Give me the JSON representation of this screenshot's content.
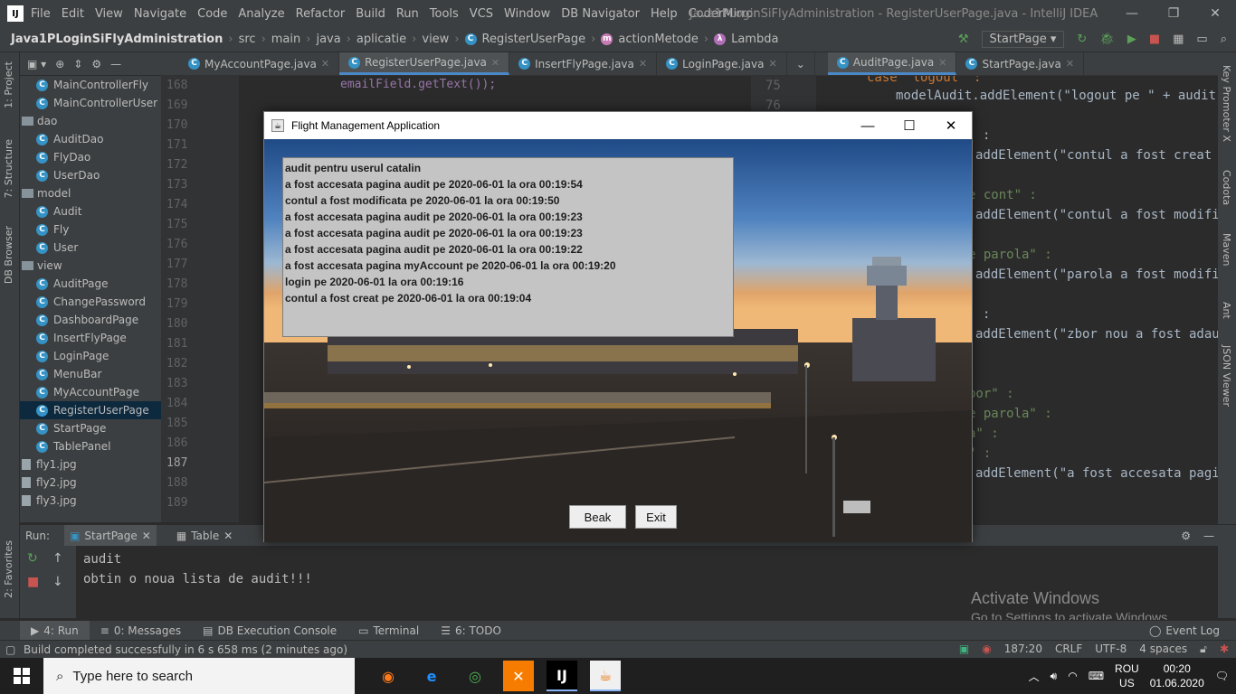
{
  "ide": {
    "menu": [
      "File",
      "Edit",
      "View",
      "Navigate",
      "Code",
      "Analyze",
      "Refactor",
      "Build",
      "Run",
      "Tools",
      "VCS",
      "Window",
      "DB Navigator",
      "Help",
      "CoderMirror"
    ],
    "window_title": "Java1PLoginSiFlyAdministration - RegisterUserPage.java - IntelliJ IDEA",
    "breadcrumb": [
      "Java1PLoginSiFlyAdministration",
      "src",
      "main",
      "java",
      "aplicatie",
      "view",
      "RegisterUserPage",
      "actionMetode",
      "Lambda"
    ],
    "run_config": "StartPage",
    "editor_tabs": [
      {
        "label": "MyAccountPage.java",
        "active": false
      },
      {
        "label": "RegisterUserPage.java",
        "active": true
      },
      {
        "label": "InsertFlyPage.java",
        "active": false
      },
      {
        "label": "LoginPage.java",
        "active": false
      },
      {
        "label": "AuditPage.java",
        "active": true
      },
      {
        "label": "StartPage.java",
        "active": false
      }
    ],
    "project_tree": [
      {
        "label": "MainControllerFly",
        "type": "class",
        "indent": 1
      },
      {
        "label": "MainControllerUser",
        "type": "class",
        "indent": 1
      },
      {
        "label": "dao",
        "type": "folder",
        "indent": 0
      },
      {
        "label": "AuditDao",
        "type": "class",
        "indent": 1
      },
      {
        "label": "FlyDao",
        "type": "class",
        "indent": 1
      },
      {
        "label": "UserDao",
        "type": "class",
        "indent": 1
      },
      {
        "label": "model",
        "type": "folder",
        "indent": 0
      },
      {
        "label": "Audit",
        "type": "class",
        "indent": 1
      },
      {
        "label": "Fly",
        "type": "class",
        "indent": 1
      },
      {
        "label": "User",
        "type": "class",
        "indent": 1
      },
      {
        "label": "view",
        "type": "folder",
        "indent": 0
      },
      {
        "label": "AuditPage",
        "type": "class",
        "indent": 1
      },
      {
        "label": "ChangePassword",
        "type": "class",
        "indent": 1
      },
      {
        "label": "DashboardPage",
        "type": "class",
        "indent": 1
      },
      {
        "label": "InsertFlyPage",
        "type": "class",
        "indent": 1
      },
      {
        "label": "LoginPage",
        "type": "class",
        "indent": 1
      },
      {
        "label": "MenuBar",
        "type": "class",
        "indent": 1
      },
      {
        "label": "MyAccountPage",
        "type": "class",
        "indent": 1
      },
      {
        "label": "RegisterUserPage",
        "type": "class",
        "indent": 1,
        "selected": true
      },
      {
        "label": "StartPage",
        "type": "class",
        "indent": 1
      },
      {
        "label": "TablePanel",
        "type": "class",
        "indent": 1
      },
      {
        "label": "fly1.jpg",
        "type": "file",
        "indent": 0
      },
      {
        "label": "fly2.jpg",
        "type": "file",
        "indent": 0
      },
      {
        "label": "fly3.jpg",
        "type": "file",
        "indent": 0
      }
    ],
    "line_numbers": [
      "168",
      "169",
      "170",
      "171",
      "172",
      "173",
      "174",
      "175",
      "176",
      "177",
      "178",
      "179",
      "180",
      "181",
      "182",
      "183",
      "184",
      "185",
      "186",
      "187",
      "188",
      "189"
    ],
    "current_line": "187",
    "code_line_168": "emailField.getText());",
    "right_line_numbers": [
      "75",
      "76"
    ],
    "right_code": {
      "case_logout": "case \"logout\" :",
      "logout_line": "modelAudit.addElement(\"logout pe \" + audit.ge",
      "colon1": ":",
      "cont_creat": "addElement(\"contul a fost creat pe",
      "cont_label": "e cont\" :",
      "cont_modif": "addElement(\"contul a fost modifica",
      "parola_label": "e parola\" :",
      "parola_modif": "addElement(\"parola a fost modific",
      "colon2": ":",
      "zbor_nou": "addElement(\"zbor nou a fost adauga",
      "zbor_label": "bor\" :",
      "parola_label2": "e parola\" :",
      "a_label": "a\" :",
      "quote_label": "\" :",
      "accesata": "addElement(\"a fost accesata pagina"
    },
    "run_tabs": {
      "label": "Run:",
      "tab1": "StartPage",
      "tab2": "Table"
    },
    "console_lines": [
      "audit",
      "obtin o noua lista de audit!!!"
    ],
    "bottom_tabs": [
      "4: Run",
      "0: Messages",
      "DB Execution Console",
      "Terminal",
      "6: TODO"
    ],
    "event_log": "Event Log",
    "status_message": "Build completed successfully in 6 s 658 ms (2 minutes ago)",
    "status_right": [
      "187:20",
      "CRLF",
      "UTF-8",
      "4 spaces"
    ],
    "left_tool_tabs": [
      "1: Project",
      "7: Structure",
      "DB Browser",
      "2: Favorites"
    ],
    "right_tool_tabs": [
      "Key Promoter X",
      "Codota",
      "Maven",
      "Ant",
      "JSON Viewer"
    ]
  },
  "dialog": {
    "title": "Flight Management Application",
    "audit_lines": [
      "audit pentru userul  catalin",
      "a fost accesata pagina audit pe 2020-06-01 la ora  00:19:54",
      "contul a fost modificata pe 2020-06-01 la ora  00:19:50",
      "a fost accesata pagina audit pe 2020-06-01 la ora  00:19:23",
      "a fost accesata pagina audit pe 2020-06-01 la ora  00:19:23",
      "a fost accesata pagina audit pe 2020-06-01 la ora  00:19:22",
      "a fost accesata pagina myAccount pe 2020-06-01 la ora  00:19:20",
      "login pe 2020-06-01 la ora  00:19:16",
      "contul a fost creat pe 2020-06-01 la ora  00:19:04"
    ],
    "back_button": "Beak",
    "exit_button": "Exit"
  },
  "watermark": {
    "line1": "Activate Windows",
    "line2": "Go to Settings to activate Windows."
  },
  "taskbar": {
    "search_placeholder": "Type here to search",
    "language": "ROU",
    "region": "US",
    "time": "00:20",
    "date": "01.06.2020"
  }
}
